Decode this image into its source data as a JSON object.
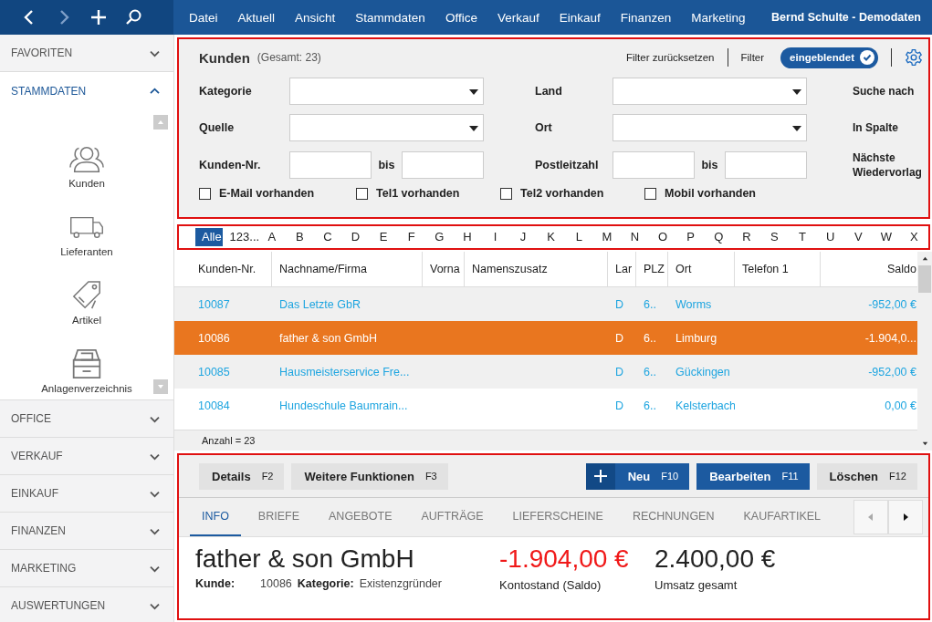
{
  "menu": [
    "Datei",
    "Aktuell",
    "Ansicht",
    "Stammdaten",
    "Office",
    "Verkauf",
    "Einkauf",
    "Finanzen",
    "Marketing"
  ],
  "user": "Bernd Schulte - Demodaten",
  "sidebar": [
    {
      "label": "FAVORITEN",
      "expanded": false
    },
    {
      "label": "STAMMDATEN",
      "expanded": true,
      "items": [
        "Kunden",
        "Lieferanten",
        "Artikel",
        "Anlagenverzeichnis"
      ]
    },
    {
      "label": "OFFICE",
      "expanded": false
    },
    {
      "label": "VERKAUF",
      "expanded": false
    },
    {
      "label": "EINKAUF",
      "expanded": false
    },
    {
      "label": "FINANZEN",
      "expanded": false
    },
    {
      "label": "MARKETING",
      "expanded": false
    },
    {
      "label": "AUSWERTUNGEN",
      "expanded": false
    }
  ],
  "filter": {
    "title": "Kunden",
    "count": "(Gesamt: 23)",
    "reset": "Filter zurücksetzen",
    "filter_label": "Filter",
    "toggle": {
      "label": "eingeblendet",
      "on": true
    },
    "rows": [
      [
        {
          "label": "Kategorie",
          "kind": "select"
        },
        {
          "label": "Land",
          "kind": "select"
        },
        {
          "label": "Suche nach"
        }
      ],
      [
        {
          "label": "Quelle",
          "kind": "select"
        },
        {
          "label": "Ort",
          "kind": "select"
        },
        {
          "label": "In Spalte"
        }
      ],
      [
        {
          "label": "Kunden-Nr.",
          "kind": "range",
          "to": "bis"
        },
        {
          "label": "Postleitzahl",
          "kind": "range",
          "to": "bis"
        },
        {
          "label": "Nächste Wiedervorlag"
        }
      ]
    ],
    "checks": [
      {
        "label": "E-Mail vorhanden",
        "checked": false
      },
      {
        "label": "Tel1 vorhanden",
        "checked": false
      },
      {
        "label": "Tel2 vorhanden",
        "checked": false
      },
      {
        "label": "Mobil vorhanden",
        "checked": false
      }
    ]
  },
  "letters": [
    {
      "label": "Alle",
      "selected": true
    },
    {
      "label": "123...",
      "selected": false
    },
    {
      "label": "A",
      "selected": false
    },
    {
      "label": "B",
      "selected": false
    },
    {
      "label": "C",
      "selected": false
    },
    {
      "label": "D",
      "selected": false
    },
    {
      "label": "E",
      "selected": false
    },
    {
      "label": "F",
      "selected": false
    },
    {
      "label": "G",
      "selected": false
    },
    {
      "label": "H",
      "selected": false
    },
    {
      "label": "I",
      "selected": false
    },
    {
      "label": "J",
      "selected": false
    },
    {
      "label": "K",
      "selected": false
    },
    {
      "label": "L",
      "selected": false
    },
    {
      "label": "M",
      "selected": false
    },
    {
      "label": "N",
      "selected": false
    },
    {
      "label": "O",
      "selected": false
    },
    {
      "label": "P",
      "selected": false
    },
    {
      "label": "Q",
      "selected": false
    },
    {
      "label": "R",
      "selected": false
    },
    {
      "label": "S",
      "selected": false
    },
    {
      "label": "T",
      "selected": false
    },
    {
      "label": "U",
      "selected": false
    },
    {
      "label": "V",
      "selected": false
    },
    {
      "label": "W",
      "selected": false
    },
    {
      "label": "X",
      "selected": false
    }
  ],
  "table": {
    "columns": [
      "Kunden-Nr.",
      "Nachname/Firma",
      "Vorna",
      "Namenszusatz",
      "Lar",
      "PLZ",
      "Ort",
      "Telefon 1",
      "Saldo"
    ],
    "rows": [
      {
        "selected": false,
        "cells": [
          "10087",
          "Das Letzte GbR",
          "",
          "",
          "D",
          "6..",
          "Worms",
          "",
          "-952,00 €"
        ]
      },
      {
        "selected": true,
        "cells": [
          "10086",
          "father & son GmbH",
          "",
          "",
          "D",
          "6..",
          "Limburg",
          "",
          "-1.904,0..."
        ]
      },
      {
        "selected": false,
        "cells": [
          "10085",
          "Hausmeisterservice Fre...",
          "",
          "",
          "D",
          "6..",
          "Gückingen",
          "",
          "-952,00 €"
        ]
      },
      {
        "selected": false,
        "cells": [
          "10084",
          "Hundeschule Baumrain...",
          "",
          "",
          "D",
          "6..",
          "Kelsterbach",
          "",
          "0,00 €"
        ]
      }
    ],
    "footer": "Anzahl = 23"
  },
  "actions": [
    {
      "label": "Details",
      "key": "F2",
      "kind": "plain"
    },
    {
      "label": "Weitere Funktionen",
      "key": "F3",
      "kind": "plain"
    },
    {
      "label": "Neu",
      "key": "F10",
      "kind": "add"
    },
    {
      "label": "Bearbeiten",
      "key": "F11",
      "kind": "primary"
    },
    {
      "label": "Löschen",
      "key": "F12",
      "kind": "plain"
    }
  ],
  "tabs": [
    {
      "label": "INFO",
      "selected": true
    },
    {
      "label": "BRIEFE",
      "selected": false
    },
    {
      "label": "ANGEBOTE",
      "selected": false
    },
    {
      "label": "AUFTRÄGE",
      "selected": false
    },
    {
      "label": "LIEFERSCHEINE",
      "selected": false
    },
    {
      "label": "RECHNUNGEN",
      "selected": false
    },
    {
      "label": "KAUFARTIKEL",
      "selected": false
    }
  ],
  "detail": {
    "name": "father & son GmbH",
    "fields": [
      {
        "label": "Kunde:",
        "value": "10086"
      },
      {
        "label": "Kategorie:",
        "value": "Existenzgründer"
      }
    ],
    "figures": [
      {
        "value": "-1.904,00 €",
        "label": "Kontostand (Saldo)",
        "negative": true
      },
      {
        "value": "2.400,00 €",
        "label": "Umsatz gesamt",
        "negative": false
      }
    ]
  }
}
